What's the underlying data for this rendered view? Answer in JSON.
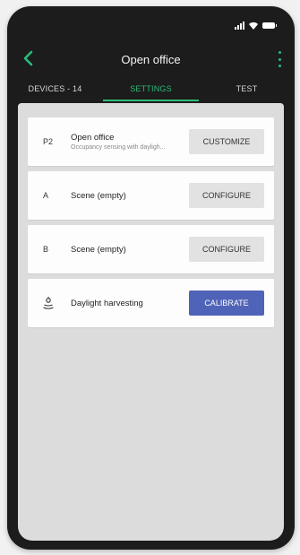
{
  "status": {
    "icons": [
      "signal-icon",
      "wifi-icon",
      "battery-icon"
    ]
  },
  "appbar": {
    "title": "Open office",
    "back_icon": "chevron-left-icon",
    "menu_icon": "more-vert-icon"
  },
  "tabs": [
    {
      "label": "DEVICES - 14"
    },
    {
      "label": "SETTINGS"
    },
    {
      "label": "TEST"
    }
  ],
  "cards": [
    {
      "lead": "P2",
      "title": "Open office",
      "subtitle": "Occupancy sensing with dayligh...",
      "button": "CUSTOMIZE"
    },
    {
      "lead": "A",
      "title": "Scene (empty)",
      "button": "CONFIGURE"
    },
    {
      "lead": "B",
      "title": "Scene (empty)",
      "button": "CONFIGURE"
    },
    {
      "lead_icon": "daylight-sensor-icon",
      "title": "Daylight harvesting",
      "button": "CALIBRATE"
    }
  ],
  "colors": {
    "accent": "#2bbb7a",
    "primary_button": "#4f63b8",
    "app_background": "#1c1c1c",
    "content_background": "#dcdcdc"
  }
}
